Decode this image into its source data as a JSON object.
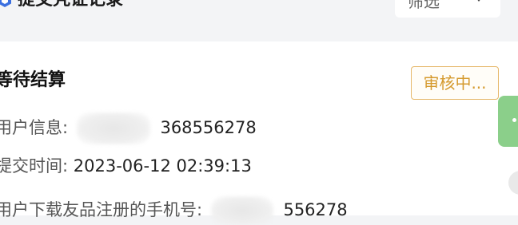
{
  "header": {
    "title": "提交凭证记录",
    "filter_label": "筛选",
    "icons": {
      "header": "shield-cube-icon",
      "filter": "chevron-down-icon"
    }
  },
  "record": {
    "status_title": "等待结算",
    "badge": "审核中...",
    "user_info_label": "用户信息:",
    "user_info_value": "368556278",
    "submit_time_label": "提交时间:",
    "submit_time_value": "2023-06-12 02:39:13",
    "phone_label": "用户下载友品注册的手机号:",
    "phone_value": "556278"
  },
  "colors": {
    "badge": "#d59a2e",
    "badge_border": "#e6b86b",
    "header_icon": "#3b6fe0",
    "side_tab": "#8bcf8a"
  }
}
